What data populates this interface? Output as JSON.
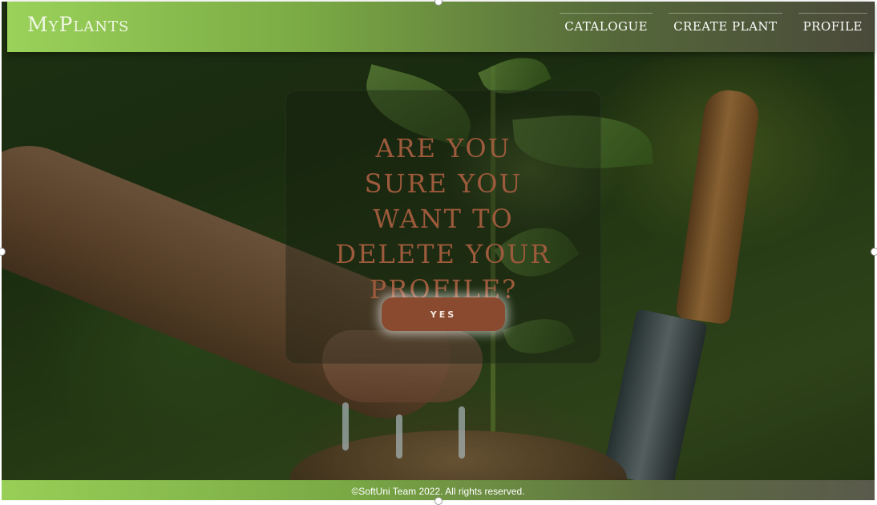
{
  "header": {
    "logo": "MyPlants",
    "nav": [
      {
        "label": "CATALOGUE"
      },
      {
        "label": "CREATE PLANT"
      },
      {
        "label": "PROFILE"
      }
    ]
  },
  "dialog": {
    "title": "Are you sure you want to delete your profile?",
    "confirm_label": "YES"
  },
  "footer": {
    "text": "©SoftUni Team 2022. All rights reserved."
  },
  "colors": {
    "header_start": "#9ad25a",
    "dialog_title": "#9d5a3c",
    "button": "#8a4a30"
  }
}
